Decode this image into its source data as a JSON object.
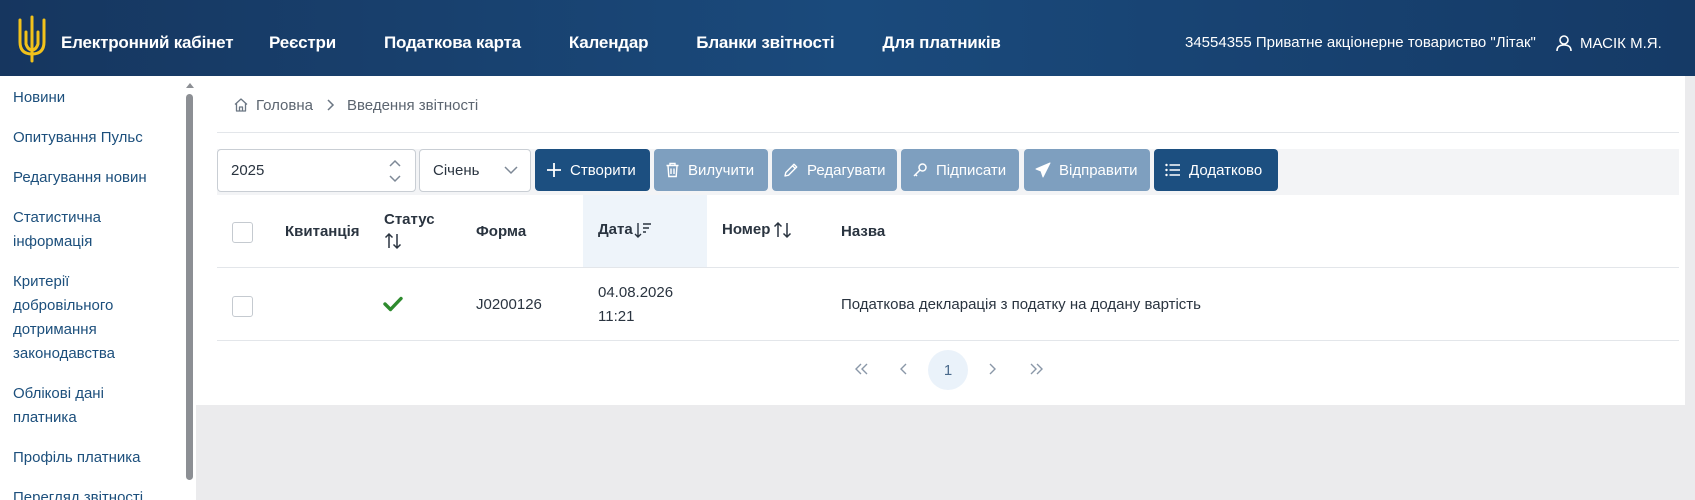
{
  "header": {
    "brand": "Електронний кабінет",
    "nav": [
      "Реєстри",
      "Податкова карта",
      "Календар",
      "Бланки звітності",
      "Для платників"
    ],
    "company": "34554355 Приватне акціонерне товариство \"Літак\"",
    "user": "МАСІК М.Я."
  },
  "sidebar": {
    "items": [
      "Новини",
      "Опитування Пульс",
      "Редагування новин",
      "Статистична інформація",
      "Критерії добровільного дотримання законодавства",
      "Облікові дані платника",
      "Профіль платника",
      "Перегляд звітності"
    ]
  },
  "breadcrumb": {
    "home": "Головна",
    "current": "Введення звітності"
  },
  "toolbar": {
    "year": "2025",
    "month": "Січень",
    "create": "Створити",
    "delete": "Вилучити",
    "edit": "Редагувати",
    "sign": "Підписати",
    "send": "Відправити",
    "more": "Додатково"
  },
  "table": {
    "headers": {
      "receipt": "Квитанція",
      "status": "Статус",
      "form": "Форма",
      "date": "Дата",
      "number": "Номер",
      "name": "Назва"
    },
    "rows": [
      {
        "receipt": "",
        "status": "ok",
        "form": "J0200126",
        "date": "04.08.2026",
        "time": "11:21",
        "number": "",
        "name": "Податкова декларація з податку на додану вартість"
      }
    ]
  },
  "pagination": {
    "current": "1"
  },
  "colors": {
    "header": "#1a4a7c",
    "primary": "#1c4f80",
    "disabled": "#7e9fbf",
    "success": "#2e8b2e"
  }
}
